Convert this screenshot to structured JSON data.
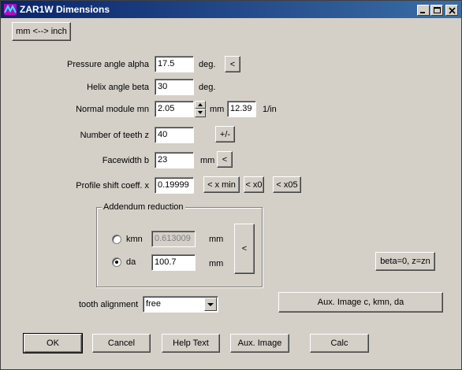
{
  "window": {
    "title": "ZAR1W Dimensions"
  },
  "unit_toggle": "mm <--> inch",
  "rows": {
    "pressure_angle": {
      "label": "Pressure angle alpha",
      "value": "17.5",
      "unit": "deg.",
      "button": "<"
    },
    "helix_angle": {
      "label": "Helix angle beta",
      "value": "30",
      "unit": "deg."
    },
    "normal_module": {
      "label": "Normal module mn",
      "value": "2.05",
      "unit": "mm",
      "value2": "12.39",
      "unit2": "1/in"
    },
    "teeth": {
      "label": "Number of teeth z",
      "value": "40",
      "button": "+/-"
    },
    "facewidth": {
      "label": "Facewidth b",
      "value": "23",
      "unit": "mm",
      "button": "<"
    },
    "profile_shift": {
      "label": "Profile shift coeff. x",
      "value": "0.19999",
      "buttons": [
        "< x min",
        "< x0",
        "< x05"
      ]
    }
  },
  "addendum": {
    "title": "Addendum reduction",
    "kmn": {
      "label": "kmn",
      "value": "0.613009",
      "unit": "mm",
      "selected": false
    },
    "da": {
      "label": "da",
      "value": "100.7",
      "unit": "mm",
      "selected": true
    },
    "button": "<"
  },
  "beta_button": "beta=0, z=zn",
  "tooth_alignment": {
    "label": "tooth alignment",
    "value": "free"
  },
  "aux_image_ckmn": "Aux. Image c, kmn, da",
  "bottom_buttons": {
    "ok": "OK",
    "cancel": "Cancel",
    "help": "Help Text",
    "aux": "Aux. Image",
    "calc": "Calc"
  }
}
